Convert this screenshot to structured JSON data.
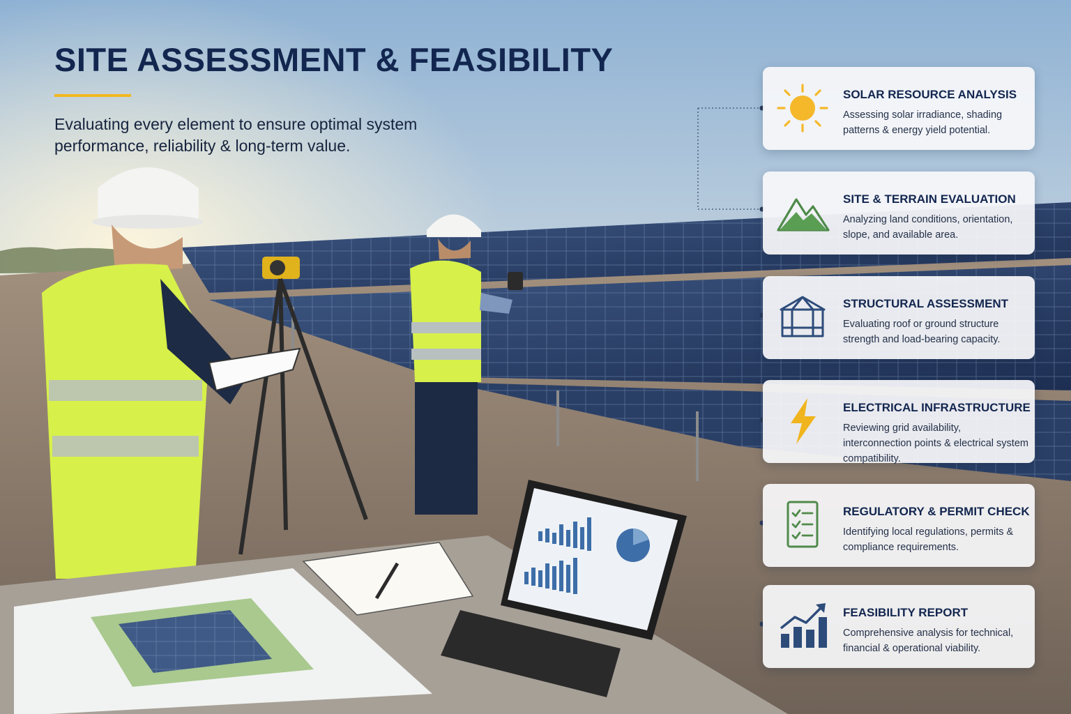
{
  "header": {
    "title": "SITE ASSESSMENT & FEASIBILITY",
    "subtitle": "Evaluating every element to ensure optimal system performance, reliability & long-term value."
  },
  "colors": {
    "title": "#12264f",
    "accent": "#f2b81f",
    "sun": "#f5b82a",
    "terrain": "#5a9e54",
    "structure": "#2d4c7a",
    "bolt": "#f0b51e",
    "checklist": "#4f8a4a",
    "chart": "#2d4c7a"
  },
  "steps": [
    {
      "icon": "sun-icon",
      "title": "SOLAR RESOURCE ANALYSIS",
      "desc": "Assessing solar irradiance, shading patterns & energy yield potential."
    },
    {
      "icon": "mountain-icon",
      "title": "SITE & TERRAIN EVALUATION",
      "desc": "Analyzing land conditions, orientation, slope, and available area."
    },
    {
      "icon": "structure-icon",
      "title": "STRUCTURAL ASSESSMENT",
      "desc": "Evaluating roof or ground structure strength and load-bearing capacity."
    },
    {
      "icon": "lightning-bolt-icon",
      "title": "ELECTRICAL INFRASTRUCTURE",
      "desc": "Reviewing grid availability, interconnection points & electrical system compatibility."
    },
    {
      "icon": "checklist-icon",
      "title": "REGULATORY & PERMIT CHECK",
      "desc": "Identifying local regulations, permits & compliance requirements."
    },
    {
      "icon": "growth-chart-icon",
      "title": "FEASIBILITY REPORT",
      "desc": "Comprehensive analysis for technical, financial & operational viability."
    }
  ]
}
